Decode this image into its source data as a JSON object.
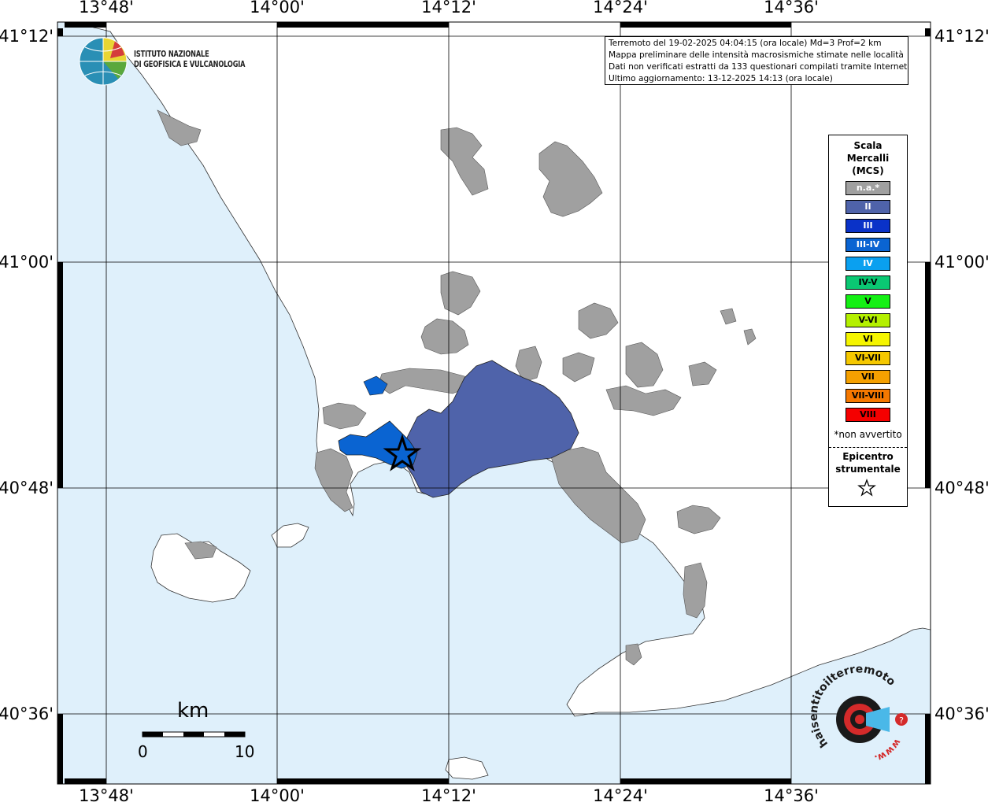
{
  "title_box": {
    "line1": "Terremoto del 19-02-2025 04:04:15 (ora locale) Md=3 Prof=2 km",
    "line2": "Mappa preliminare delle intensità macrosismiche stimate nelle località",
    "line3": "Dati non verificati estratti da 133 questionari compilati tramite Internet.",
    "line4": "Ultimo aggiornamento: 13-12-2025 14:13 (ora locale)"
  },
  "ingv_logo": {
    "line1": "ISTITUTO NAZIONALE",
    "line2": "DI GEOFISICA E VULCANOLOGIA"
  },
  "longitude_labels": [
    "13°48'",
    "14°00'",
    "14°12'",
    "14°24'",
    "14°36'"
  ],
  "latitude_labels": [
    "41°12'",
    "41°00'",
    "40°48'",
    "40°36'"
  ],
  "legend": {
    "title": "Scala\nMercalli\n(MCS)",
    "items": [
      {
        "label": "n.a.*",
        "color": "#a0a0a0",
        "text_color": "#ffffff"
      },
      {
        "label": "II",
        "color": "#4f63aa",
        "text_color": "#ffffff"
      },
      {
        "label": "III",
        "color": "#0a32c8",
        "text_color": "#ffffff"
      },
      {
        "label": "III-IV",
        "color": "#0a64d2",
        "text_color": "#ffffff"
      },
      {
        "label": "IV",
        "color": "#0aa0f0",
        "text_color": "#ffffff"
      },
      {
        "label": "IV-V",
        "color": "#0ac873",
        "text_color": "#000000"
      },
      {
        "label": "V",
        "color": "#14f014",
        "text_color": "#000000"
      },
      {
        "label": "V-VI",
        "color": "#b4f000",
        "text_color": "#000000"
      },
      {
        "label": "VI",
        "color": "#f5f500",
        "text_color": "#000000"
      },
      {
        "label": "VI-VII",
        "color": "#f5c800",
        "text_color": "#000000"
      },
      {
        "label": "VII",
        "color": "#f5a000",
        "text_color": "#000000"
      },
      {
        "label": "VII-VIII",
        "color": "#f57800",
        "text_color": "#000000"
      },
      {
        "label": "VIII",
        "color": "#f50000",
        "text_color": "#000000"
      }
    ],
    "not_felt_note": "*non avvertito",
    "epicenter_label": "Epicentro\nstrumentale"
  },
  "scale_bar": {
    "unit": "km",
    "min_label": "0",
    "max_label": "10"
  },
  "hst_logo": {
    "text": "haisentitoilterremoto.it",
    "prefix": "www."
  },
  "colors": {
    "sea": "#dff0fb",
    "land": "#ffffff",
    "na_municipality": "#a0a0a0",
    "intensity_II": "#4f63aa",
    "intensity_III_IV": "#0a64d2"
  }
}
